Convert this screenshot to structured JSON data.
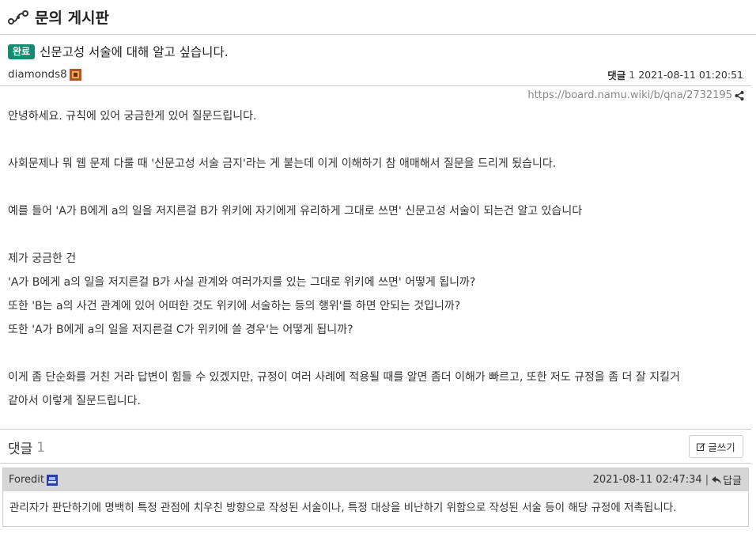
{
  "board": {
    "title": "문의 게시판"
  },
  "post": {
    "status_badge": "완료",
    "title": "신문고성 서술에 대해 알고 싶습니다.",
    "author": "diamonds8",
    "comments_label": "댓글",
    "comments_count": "1",
    "datetime": "2021-08-11 01:20:51",
    "permalink": "https://board.namu.wiki/b/qna/2732195",
    "paragraphs": [
      [
        "안녕하세요. 규칙에 있어 궁금한게 있어 질문드립니다."
      ],
      [
        "사회문제나 뭐 웹 문제 다룰 때 '신문고성 서술 금지'라는 게 붙는데 이게 이해하기 참 애매해서 질문을 드리게 됬습니다."
      ],
      [
        "예를 들어 'A가 B에게 a의 일을 저지른걸 B가 위키에 자기에게 유리하게 그대로 쓰면' 신문고성 서술이 되는건 알고 있습니다"
      ],
      [
        "제가 궁금한 건",
        "'A가 B에게 a의 일을 저지른걸 B가 사실 관계와 여러가지를 있는 그대로 위키에 쓰면' 어떻게 됩니까?",
        "또한 'B는 a의 사건 관계에 있어 어떠한 것도 위키에 서술하는 등의 행위'를 하면 안되는 것입니까?",
        "또한 'A가 B에게 a의 일을 저지른걸 C가 위키에 쓸 경우'는 어떻게 됩니까?"
      ],
      [
        "이게 좀 단순화를 거친 거라 답변이 힘들 수 있겠지만, 규정이 여러 사례에 적용될 때를 알면 좀더 이해가 빠르고, 또한 저도 규정을 좀 더 잘 지킬거",
        "같아서 이렇게 질문드립니다."
      ]
    ]
  },
  "comments_section": {
    "header_label": "댓글",
    "count": "1",
    "write_button": "글쓰기"
  },
  "comment": {
    "author": "Foredit",
    "datetime": "2021-08-11 02:47:34",
    "separator": "|",
    "reply_label": "답글",
    "text": "관리자가 판단하기에 명백히 특정 관점에 치우친 방향으로 작성된 서술이나, 특정 대상을 비난하기 위함으로 작성된 서술 등이 해당 규정에 저촉됩니다."
  },
  "icons": {
    "board_icon": "route-icon",
    "author_badge": "user-badge-icon",
    "share": "share-icon",
    "write": "pencil-icon",
    "reply": "reply-icon"
  },
  "colors": {
    "badge": "#1a8a6f",
    "comment_head": "#d6d6d6"
  }
}
